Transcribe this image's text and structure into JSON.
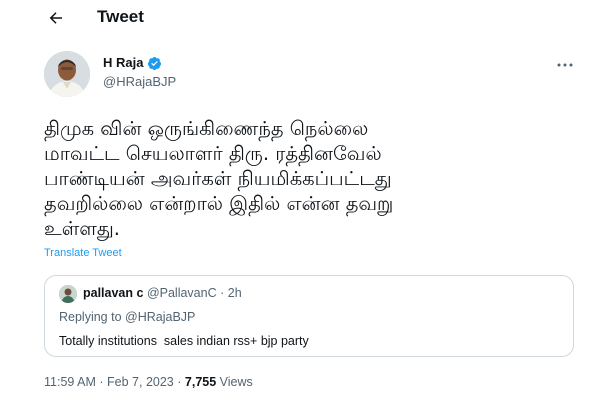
{
  "header": {
    "title": "Tweet",
    "back_icon": "arrow-left-icon"
  },
  "author": {
    "name": "H Raja",
    "handle": "@HRajaBJP",
    "verified_color": "#1d9bf0"
  },
  "tweet": {
    "lines": [
      "திமுக வின் ஒருங்கிணைந்த நெல்லை",
      "மாவட்ட செயலாளர் திரு. ரத்தினவேல்",
      "பாண்டியன் அவர்கள் நியமிக்கப்பட்டது",
      "தவறில்லை என்றால் இதில் என்ன தவறு",
      "உள்ளது."
    ],
    "translate_label": "Translate Tweet"
  },
  "quote": {
    "name": "pallavan c",
    "handle": "@PallavanC",
    "separator": "·",
    "time": "2h",
    "replying_prefix": "Replying to",
    "replying_to": "@HRajaBJP",
    "text": "Totally institutions  sales indian rss+ bjp party"
  },
  "meta": {
    "time": "11:59 AM",
    "separator1": "·",
    "date": "Feb 7, 2023",
    "separator2": "·",
    "views_count": "7,755",
    "views_label": "Views"
  },
  "colors": {
    "accent": "#1d9bf0",
    "secondary_text": "#536471",
    "border": "#cfd9de"
  }
}
